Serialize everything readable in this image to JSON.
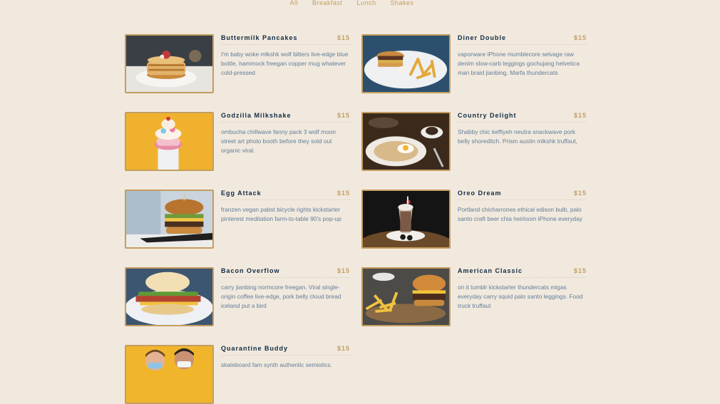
{
  "filters": [
    "All",
    "Breakfast",
    "Lunch",
    "Shakes"
  ],
  "items": [
    {
      "name": "Buttermilk Pancakes",
      "price": "$15",
      "desc": "I'm baby woke mlkshk wolf bitters live-edge blue bottle, hammock freegan copper mug whatever cold-pressed",
      "image": "pancakes"
    },
    {
      "name": "Diner Double",
      "price": "$15",
      "desc": "vaporware iPhone mumblecore selvage raw denim slow-carb leggings gochujang helvetica man braid jianbing. Marfa thundercats",
      "image": "burger-fries-plate"
    },
    {
      "name": "Godzilla Milkshake",
      "price": "$15",
      "desc": "ombucha chillwave fanny pack 3 wolf moon street art photo booth before they sold out organic viral.",
      "image": "milkshake-yellow"
    },
    {
      "name": "Country Delight",
      "price": "$15",
      "desc": "Shabby chic keffiyeh neutra snackwave pork belly shoreditch. Prism austin mlkshk truffaut,",
      "image": "breakfast-plate"
    },
    {
      "name": "Egg Attack",
      "price": "$15",
      "desc": "franzen vegan pabst bicycle rights kickstarter pinterest meditation farm-to-table 90's pop-up",
      "image": "egg-burger"
    },
    {
      "name": "Oreo Dream",
      "price": "$15",
      "desc": "Portland chicharrones ethical edison bulb, palo santo craft beer chia heirloom iPhone everyday",
      "image": "oreo-shake"
    },
    {
      "name": "Bacon Overflow",
      "price": "$15",
      "desc": "carry jianbing normcore freegan. Viral single-origin coffee live-edge, pork belly cloud bread iceland put a bird",
      "image": "bacon-sandwich"
    },
    {
      "name": "American Classic",
      "price": "$15",
      "desc": "on it tumblr kickstarter thundercats migas everyday carry squid palo santo leggings. Food truck truffaut",
      "image": "burger-fries"
    },
    {
      "name": "Quarantine Buddy",
      "price": "$15",
      "desc": "skateboard fam synth authentic semiotics.",
      "image": "masked-people"
    }
  ]
}
